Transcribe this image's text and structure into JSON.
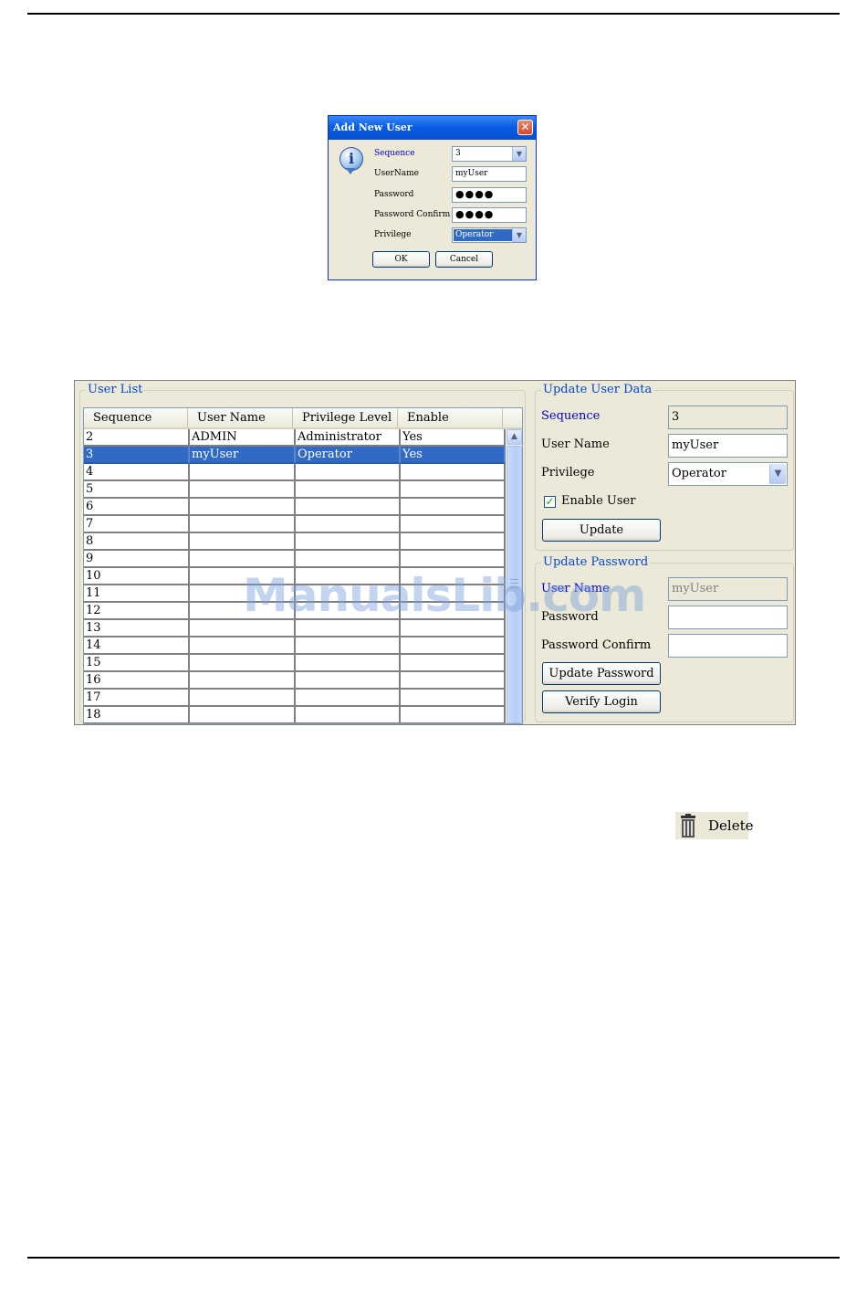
{
  "dialog": {
    "title": "Add New User",
    "close_glyph": "✕",
    "info_glyph": "i",
    "icon": "info-icon",
    "fields": [
      {
        "label": "Sequence",
        "value": "3",
        "type": "combo"
      },
      {
        "label": "UserName",
        "value": "myUser",
        "type": "text"
      },
      {
        "label": "Password",
        "value": "●●●●",
        "type": "password"
      },
      {
        "label": "Password Confirm",
        "value": "●●●●",
        "type": "password"
      },
      {
        "label": "Privilege",
        "value": "Operator",
        "type": "combo"
      }
    ],
    "ok_label": "OK",
    "cancel_label": "Cancel"
  },
  "user_list": {
    "title": "User List",
    "columns": [
      "Sequence",
      "User Name",
      "Privilege Level",
      "Enable"
    ],
    "rows": [
      [
        "2",
        "ADMIN",
        "Administrator",
        "Yes"
      ],
      [
        "3",
        "myUser",
        "Operator",
        "Yes"
      ],
      [
        "4",
        "",
        "",
        ""
      ],
      [
        "5",
        "",
        "",
        ""
      ],
      [
        "6",
        "",
        "",
        ""
      ],
      [
        "7",
        "",
        "",
        ""
      ],
      [
        "8",
        "",
        "",
        ""
      ],
      [
        "9",
        "",
        "",
        ""
      ],
      [
        "10",
        "",
        "",
        ""
      ],
      [
        "11",
        "",
        "",
        ""
      ],
      [
        "12",
        "",
        "",
        ""
      ],
      [
        "13",
        "",
        "",
        ""
      ],
      [
        "14",
        "",
        "",
        ""
      ],
      [
        "15",
        "",
        "",
        ""
      ],
      [
        "16",
        "",
        "",
        ""
      ],
      [
        "17",
        "",
        "",
        ""
      ],
      [
        "18",
        "",
        "",
        ""
      ]
    ],
    "selected_row": 1
  },
  "update_user": {
    "title": "Update User Data",
    "sequence_label": "Sequence",
    "sequence_value": "3",
    "username_label": "User Name",
    "username_value": "myUser",
    "privilege_label": "Privilege",
    "privilege_value": "Operator",
    "enable_label": "Enable User",
    "enable_checked": true,
    "check_glyph": "✓",
    "update_label": "Update"
  },
  "update_password": {
    "title": "Update Password",
    "username_label": "User Name",
    "username_value": "myUser",
    "password_label": "Password",
    "password_value": "",
    "confirm_label": "Password Confirm",
    "confirm_value": "",
    "update_password_label": "Update Password",
    "verify_login_label": "Verify Login"
  },
  "watermark": "ManualsLib.com",
  "delete_button": {
    "label": "Delete",
    "icon": "trash-icon"
  },
  "colors": {
    "selection": "#316AC5",
    "group_title": "#0046D5",
    "dialog_bg": "#ECE9D8"
  }
}
